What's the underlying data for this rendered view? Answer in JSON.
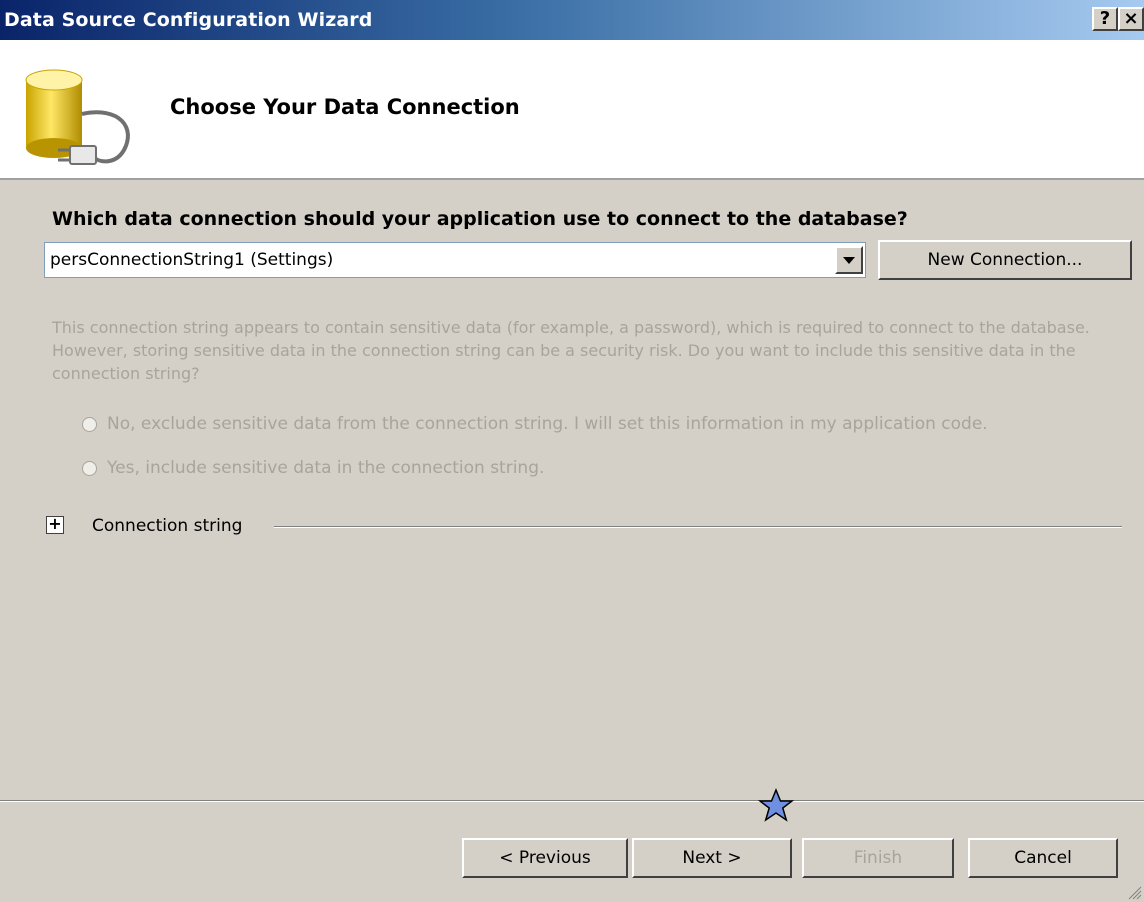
{
  "window": {
    "title": "Data Source Configuration Wizard",
    "help_button": "?",
    "close_button": "×"
  },
  "header": {
    "heading": "Choose Your Data Connection",
    "icon": "database-plug-icon"
  },
  "question": "Which data connection should your application use to connect to the database?",
  "connection_select": {
    "selected": "persConnectionString1 (Settings)"
  },
  "new_connection_label": "New Connection...",
  "notice": "This connection string appears to contain sensitive data (for example, a password), which is required to connect to the database. However, storing sensitive data in the connection string can be a security risk. Do you want to include this sensitive data in the connection string?",
  "options": [
    {
      "label": "No, exclude sensitive data from the connection string. I will set this information in my application code."
    },
    {
      "label": "Yes, include sensitive data in the connection string."
    }
  ],
  "connection_string": {
    "label": "Connection string",
    "expander_symbol": "+"
  },
  "buttons": {
    "previous": "< Previous",
    "next": "Next >",
    "finish": "Finish",
    "cancel": "Cancel"
  },
  "colors": {
    "title_start": "#0a246a",
    "title_end": "#a6caf0",
    "dialog_bg": "#d4d0c8",
    "disabled_text": "#a8a49c",
    "star_fill": "#6f8fe0"
  }
}
